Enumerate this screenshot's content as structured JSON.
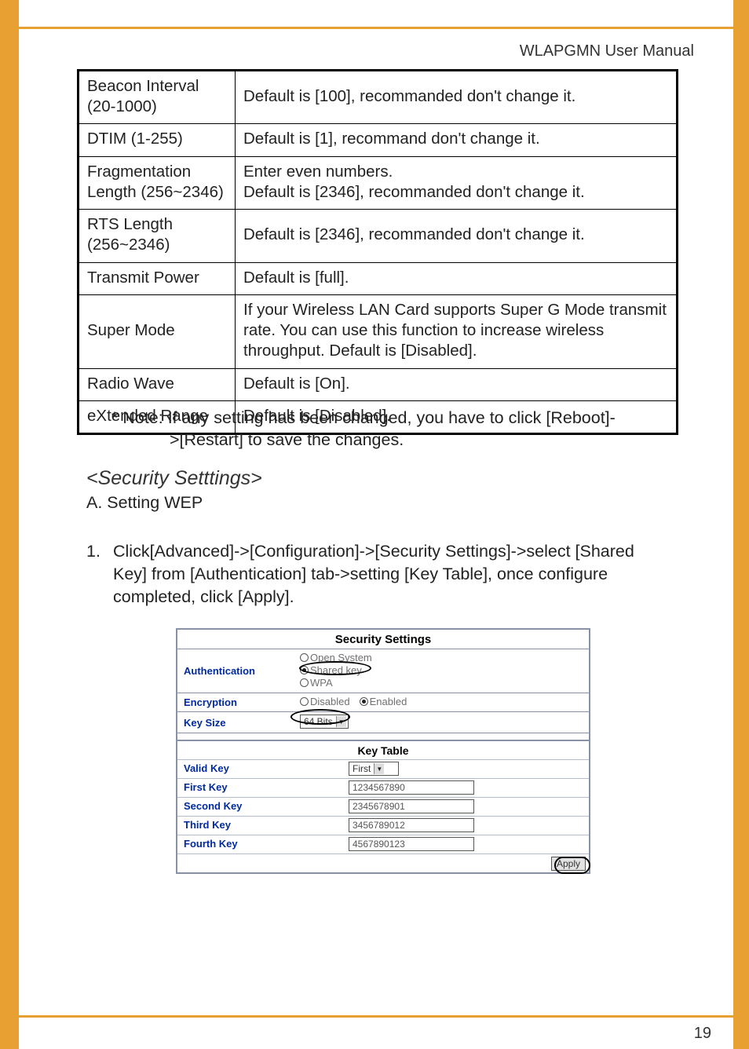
{
  "header": {
    "title": "WLAPGMN User Manual"
  },
  "table": {
    "rows": [
      {
        "name": "Beacon Interval (20-1000)",
        "desc": "Default is [100], recommanded don't change it."
      },
      {
        "name": "DTIM (1-255)",
        "desc": "Default is [1], recommand don't change it."
      },
      {
        "name": "Fragmentation Length (256~2346)",
        "desc": "Enter even numbers.\nDefault is [2346], recommanded don't change it."
      },
      {
        "name": "RTS Length (256~2346)",
        "desc": "Default is [2346], recommanded don't change it."
      },
      {
        "name": "Transmit Power",
        "desc": "Default is [full]."
      },
      {
        "name": "Super Mode",
        "desc": "If your Wireless LAN Card supports Super G Mode transmit rate. You can use this function to increase wireless throughput. Default is [Disabled]."
      },
      {
        "name": "Radio Wave",
        "desc": "Default is [On]."
      },
      {
        "name": "eXtended Range",
        "desc": "Default is [Disabled]."
      }
    ]
  },
  "note_line1": "* Note: If any setting has been changed, you have to click [Reboot]-",
  "note_line2": ">[Restart] to save the changes.",
  "security_heading": "<Security Setttings>",
  "sub_heading": "A. Setting WEP",
  "step1_num": "1.",
  "step1_text": "Click[Advanced]->[Configuration]->[Security Settings]->select [Shared Key] from [Authentication] tab->setting [Key Table], once configure completed, click [Apply].",
  "screenshot": {
    "title": "Security Settings",
    "auth_label": "Authentication",
    "auth_options": {
      "open": "Open System",
      "shared": "Shared key",
      "wpa": "WPA"
    },
    "enc_label": "Encryption",
    "enc_options": {
      "disabled": "Disabled",
      "enabled": "Enabled"
    },
    "keysize_label": "Key Size",
    "keysize_value": "64 Bits",
    "keytable_title": "Key Table",
    "validkey_label": "Valid Key",
    "validkey_value": "First",
    "keys": [
      {
        "label": "First Key",
        "value": "1234567890"
      },
      {
        "label": "Second Key",
        "value": "2345678901"
      },
      {
        "label": "Third Key",
        "value": "3456789012"
      },
      {
        "label": "Fourth Key",
        "value": "4567890123"
      }
    ],
    "apply": "Apply"
  },
  "page_number": "19"
}
